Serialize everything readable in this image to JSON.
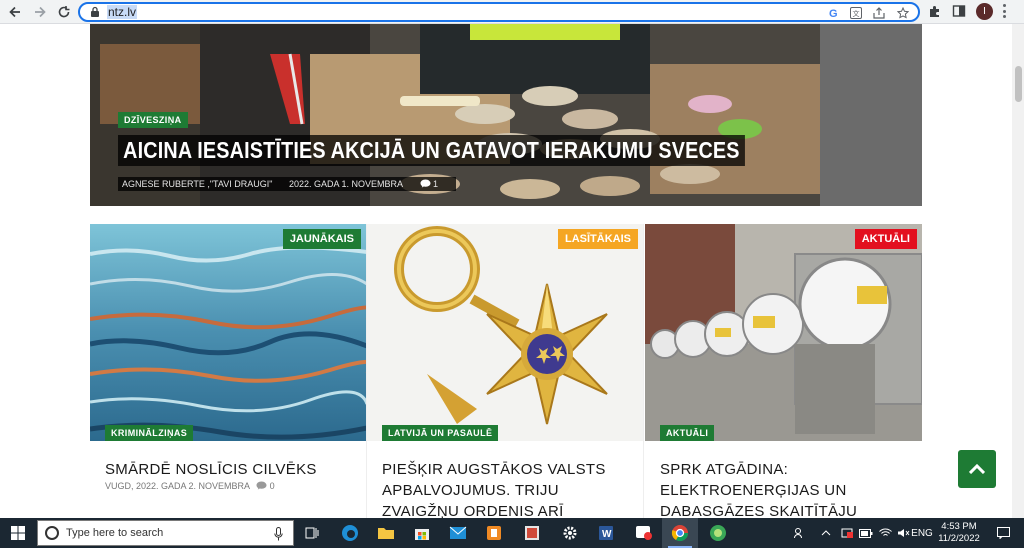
{
  "browser": {
    "url": "ntz.lv",
    "avatar_letter": "I"
  },
  "hero": {
    "category": "DZĪVESZIŅA",
    "title": "AICINA IESAISTĪTIES AKCIJĀ UN GATAVOT IERAKUMU SVECES",
    "author": "AGNESE RUBERTE ,\"TAVI DRAUGI\"",
    "date": "2022. GADA 1. NOVEMBRA",
    "comments": "1"
  },
  "cards": [
    {
      "tag": "JAUNĀKAIS",
      "tag_color": "#1e7b34",
      "category": "KRIMINĀLZIŅAS",
      "title": "SMĀRDĒ NOSLĪCIS CILVĒKS",
      "date": "VUGD, 2022. GADA 2. NOVEMBRA",
      "comments": "0"
    },
    {
      "tag": "LASĪTĀKAIS",
      "tag_color": "#f5a623",
      "category": "LATVIJĀ UN PASAULĒ",
      "title": "PIEŠĶIR AUGSTĀKOS VALSTS APBALVOJUMUS. TRIJU ZVAIGŽŅU ORDENIS ARĪ NOVADNIEKAM ULVIM"
    },
    {
      "tag": "AKTUĀLI",
      "tag_color": "#e3101f",
      "category": "AKTUĀLI",
      "title": "SPRK ATGĀDINA: ELEKTROENERĢIJAS UN DABASGĀZES SKAITĪTĀJU RĀDĪJUMI JĀNODOD SAVLAICĪGI"
    }
  ],
  "taskbar": {
    "search_placeholder": "Type here to search",
    "language": "ENG",
    "time": "4:53 PM",
    "date": "11/2/2022"
  }
}
